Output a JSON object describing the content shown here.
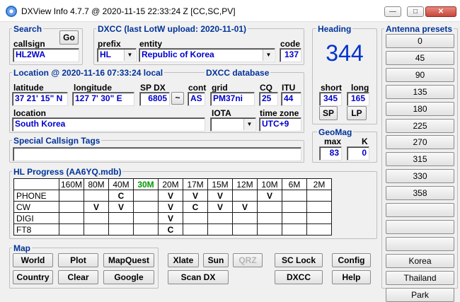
{
  "window": {
    "title": "DXView Info 4.7.7 @ 2020-11-15  22:33:24 Z  [CC,SC,PV]",
    "min_label": "—",
    "max_label": "□",
    "close_label": "✕"
  },
  "search": {
    "legend": "Search",
    "callsign_label": "callsign",
    "callsign_value": "HL2WA",
    "go_label": "Go"
  },
  "dxcc": {
    "legend": "DXCC  (last LotW upload: 2020-11-01)",
    "prefix_label": "prefix",
    "prefix_value": "HL",
    "entity_label": "entity",
    "entity_value": "Republic of Korea",
    "code_label": "code",
    "code_value": "137"
  },
  "heading": {
    "legend": "Heading",
    "value": "344",
    "short_label": "short",
    "long_label": "long",
    "short_value": "345",
    "long_value": "165",
    "sp_label": "SP",
    "lp_label": "LP"
  },
  "location": {
    "legend": "Location @ 2020-11-16 07:33:24 local",
    "db_legend": "DXCC database",
    "latitude_label": "latitude",
    "latitude_value": "37 21' 15\" N",
    "longitude_label": "longitude",
    "longitude_value": "127 7' 30\" E",
    "spdx_label": "SP DX",
    "spdx_value": "6805",
    "tilde_label": "~",
    "cont_label": "cont",
    "cont_value": "AS",
    "grid_label": "grid",
    "grid_value": "PM37ni",
    "cq_label": "CQ",
    "cq_value": "25",
    "itu_label": "ITU",
    "itu_value": "44",
    "location_label": "location",
    "location_value": "South Korea",
    "iota_label": "IOTA",
    "iota_value": "",
    "tz_label": "time zone",
    "tz_value": "UTC+9"
  },
  "geomag": {
    "legend": "GeoMag",
    "max_label": "max",
    "k_label": "K",
    "max_value": "83",
    "k_value": "0"
  },
  "tags": {
    "legend": "Special Callsign Tags",
    "value": ""
  },
  "progress": {
    "legend": "HL Progress (AA6YQ.mdb)",
    "bands": [
      "160M",
      "80M",
      "40M",
      "30M",
      "20M",
      "17M",
      "15M",
      "12M",
      "10M",
      "6M",
      "2M"
    ],
    "highlight_band": "30M",
    "rows": [
      {
        "mode": "PHONE",
        "cells": [
          "",
          "",
          "C",
          "",
          "V",
          "V",
          "V",
          "",
          "V",
          "",
          ""
        ]
      },
      {
        "mode": "CW",
        "cells": [
          "",
          "V",
          "V",
          "",
          "V",
          "C",
          "V",
          "V",
          "",
          "",
          ""
        ]
      },
      {
        "mode": "DIGI",
        "cells": [
          "",
          "",
          "",
          "",
          "V",
          "",
          "",
          "",
          "",
          "",
          ""
        ]
      },
      {
        "mode": "FT8",
        "cells": [
          "",
          "",
          "",
          "",
          "C",
          "",
          "",
          "",
          "",
          "",
          ""
        ]
      }
    ]
  },
  "map": {
    "legend": "Map",
    "world": "World",
    "plot": "Plot",
    "mapquest": "MapQuest",
    "country": "Country",
    "clear": "Clear",
    "google": "Google"
  },
  "actions": {
    "xlate": "Xlate",
    "sun": "Sun",
    "qrz": "QRZ",
    "sclock": "SC Lock",
    "config": "Config",
    "scandx": "Scan DX",
    "dxcc": "DXCC",
    "help": "Help"
  },
  "presets": {
    "legend": "Antenna presets",
    "items": [
      "0",
      "45",
      "90",
      "135",
      "180",
      "225",
      "270",
      "315",
      "330",
      "358",
      "",
      "",
      "",
      "Korea",
      "Thailand",
      "Park"
    ]
  }
}
